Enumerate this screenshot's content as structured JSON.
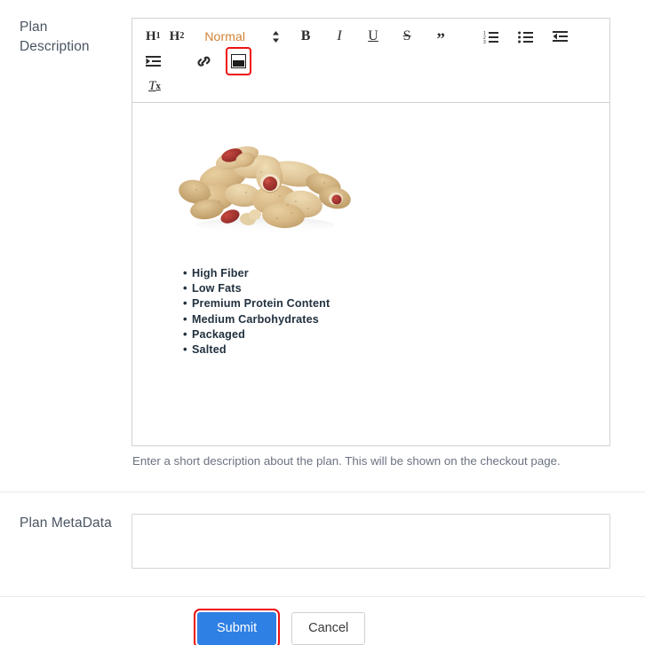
{
  "form": {
    "description_field": {
      "label_line1": "Plan",
      "label_line2": "Description",
      "help_text": "Enter a short description about the plan. This will be shown on the checkout page."
    },
    "metadata_field": {
      "label": "Plan MetaData",
      "value": "",
      "placeholder": ""
    }
  },
  "editor": {
    "toolbar": {
      "h1_label": "H",
      "h1_sub": "1",
      "h2_label": "H",
      "h2_sub": "2",
      "format_picker": {
        "selected": "Normal",
        "icon": "updown-arrows-icon"
      },
      "bold_label": "B",
      "italic_label": "I",
      "underline_label": "U",
      "strike_label": "S",
      "blockquote_label": "”",
      "ordered_list_icon": "ordered-list-icon",
      "bullet_list_icon": "bullet-list-icon",
      "outdent_icon": "outdent-icon",
      "indent_icon": "indent-icon",
      "link_icon": "link-icon",
      "image_icon": "image-icon",
      "clear_format_label": "T",
      "clear_format_sub": "x"
    },
    "content": {
      "image_alt": "pile of peanuts in shells",
      "bullets": [
        "High Fiber",
        "Low Fats",
        "Premium Protein Content",
        "Medium Carbohydrates",
        "Packaged",
        "Salted"
      ]
    }
  },
  "actions": {
    "submit_label": "Submit",
    "cancel_label": "Cancel"
  },
  "colors": {
    "primary_button": "#2f80e4",
    "highlight": "#ee1111",
    "picker_text": "#d08334",
    "label_text": "#4b5563",
    "help_text": "#6b7280",
    "border": "#cfd2d6"
  }
}
